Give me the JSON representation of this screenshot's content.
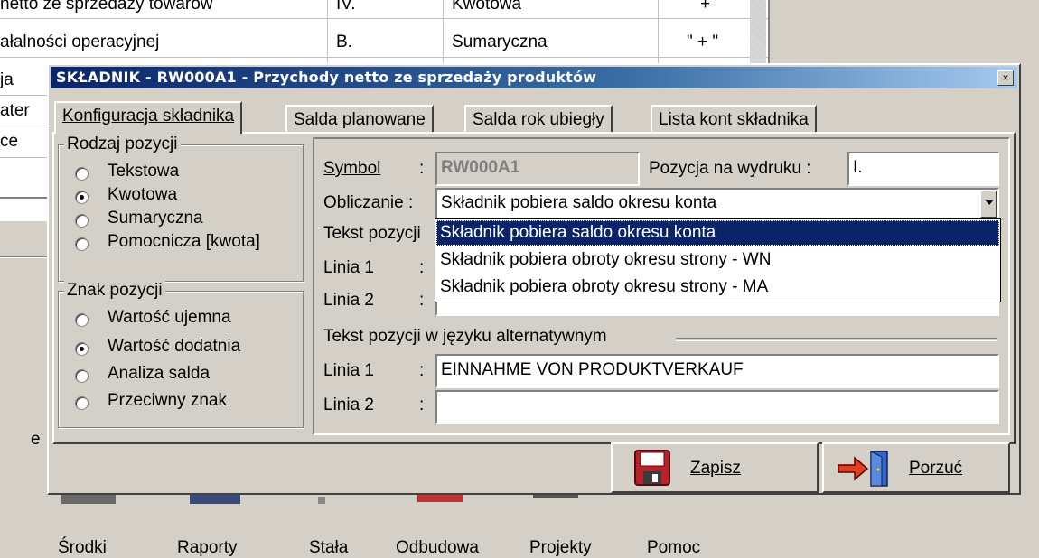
{
  "background": {
    "rows": [
      {
        "name": "netto ze sprzedaży towarów",
        "level": "IV.",
        "type": "Kwotowa",
        "sign": "+"
      },
      {
        "name": "ałalności operacyjnej",
        "level": "B.",
        "type": "Sumaryczna",
        "sign": "\" + \""
      },
      {
        "name": "ja",
        "level": "",
        "type": "",
        "sign": ""
      },
      {
        "name": "ater",
        "level": "",
        "type": "",
        "sign": ""
      },
      {
        "name": "ce",
        "level": "",
        "type": "",
        "sign": ""
      }
    ],
    "stray_letter": "e",
    "toolbar_labels": [
      "Środki",
      "Raporty",
      "Stała",
      "Odbudowa",
      "Projekty",
      "Pomoc"
    ]
  },
  "dialog": {
    "title": "SKŁADNIK - RW000A1 - Przychody netto ze sprzedaży produktów",
    "close_glyph": "×",
    "tabs": [
      {
        "label": "Konfiguracja składnika",
        "active": true
      },
      {
        "label": "Salda planowane",
        "active": false
      },
      {
        "label": "Salda rok ubiegły",
        "active": false
      },
      {
        "label": "Lista kont składnika",
        "active": false
      }
    ],
    "rodzaj": {
      "legend": "Rodzaj pozycji",
      "options": [
        {
          "label": "Tekstowa",
          "checked": false
        },
        {
          "label": "Kwotowa",
          "checked": true
        },
        {
          "label": "Sumaryczna",
          "checked": false
        },
        {
          "label": "Pomocnicza [kwota]",
          "checked": false
        }
      ]
    },
    "znak": {
      "legend": "Znak pozycji",
      "options": [
        {
          "label": "Wartość ujemna",
          "checked": false
        },
        {
          "label": "Wartość dodatnia",
          "checked": true
        },
        {
          "label": "Analiza salda",
          "checked": false
        },
        {
          "label": "Przeciwny znak",
          "checked": false
        }
      ]
    },
    "form": {
      "symbol_label": "Symbol",
      "symbol_value": "RW000A1",
      "pozycja_label": "Pozycja na wydruku :",
      "pozycja_value": "I.",
      "obliczanie_label": "Obliczanie :",
      "obliczanie_value": "Składnik pobiera saldo okresu konta",
      "tekst_pozycji_label": "Tekst pozycji",
      "linia1_label": "Linia 1",
      "linia2_label": "Linia 2",
      "colon": ":",
      "alt_section_label": "Tekst pozycji w języku alternatywnym",
      "alt_linia1_value": "EINNAHME VON PRODUKTVERKAUF",
      "alt_linia2_value": ""
    },
    "dropdown_options": [
      "Składnik pobiera saldo okresu konta",
      "Składnik pobiera obroty okresu strony - WN",
      "Składnik pobiera obroty okresu strony - MA"
    ],
    "buttons": {
      "save": "Zapisz",
      "discard": "Porzuć"
    }
  }
}
